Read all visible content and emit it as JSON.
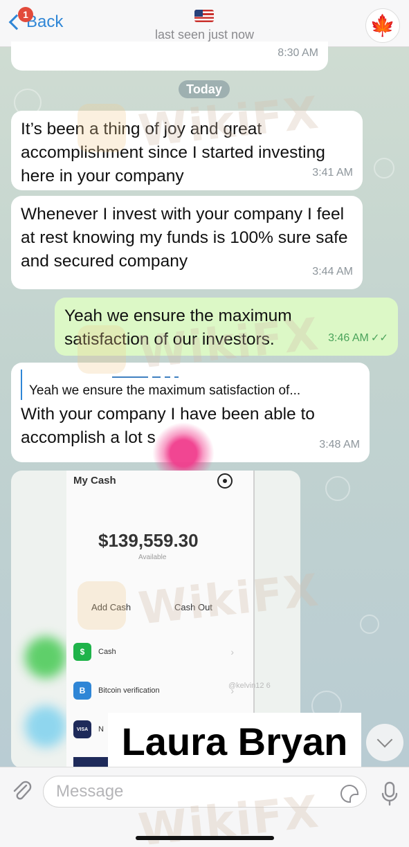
{
  "header": {
    "back_label": "Back",
    "unread_count": "1",
    "status": "last seen just now",
    "avatar_glyph": "🍁"
  },
  "chat": {
    "prior_time": "8:30 AM",
    "date_separator": "Today",
    "messages": [
      {
        "direction": "incoming",
        "text": "It’s been a thing of joy and great accomplishment since I started investing here in your company",
        "time": "3:41 AM"
      },
      {
        "direction": "incoming",
        "text": "Whenever I invest with your company I feel at rest knowing my funds is 100% sure safe and secured company",
        "time": "3:44 AM"
      },
      {
        "direction": "outgoing",
        "text": "Yeah we ensure the maximum satisfaction of our investors.",
        "time": "3:46 AM",
        "read": true
      },
      {
        "direction": "incoming",
        "reply_to": "Yeah we ensure the maximum satisfaction of...",
        "text": "With your company I have been able to accomplish a lot s",
        "time": "3:48 AM"
      }
    ],
    "check_mark": "✓✓"
  },
  "screenshot_attachment": {
    "title": "My Cash",
    "balance": "$139,559.30",
    "available_label": "Available",
    "add_cash": "Add Cash",
    "cash_out": "Cash Out",
    "rows": [
      {
        "icon_letter": "$",
        "label": "Cash",
        "color": "#1fb34a"
      },
      {
        "icon_letter": "B",
        "label": "Bitcoin verification",
        "color": "#2f86d6"
      },
      {
        "icon_letter": "VISA",
        "label": "N",
        "color": "#1e2a5a"
      }
    ],
    "side_handle": "@kelvin12\n6",
    "chevron": "›"
  },
  "overlay_name": "Laura Bryan",
  "watermark_text": "WikiFX",
  "input": {
    "placeholder": "Message"
  },
  "colors": {
    "accent": "#2f86d6",
    "outgoing_bubble": "#dcf8c6",
    "incoming_bubble": "#ffffff",
    "badge": "#e24a3b"
  }
}
